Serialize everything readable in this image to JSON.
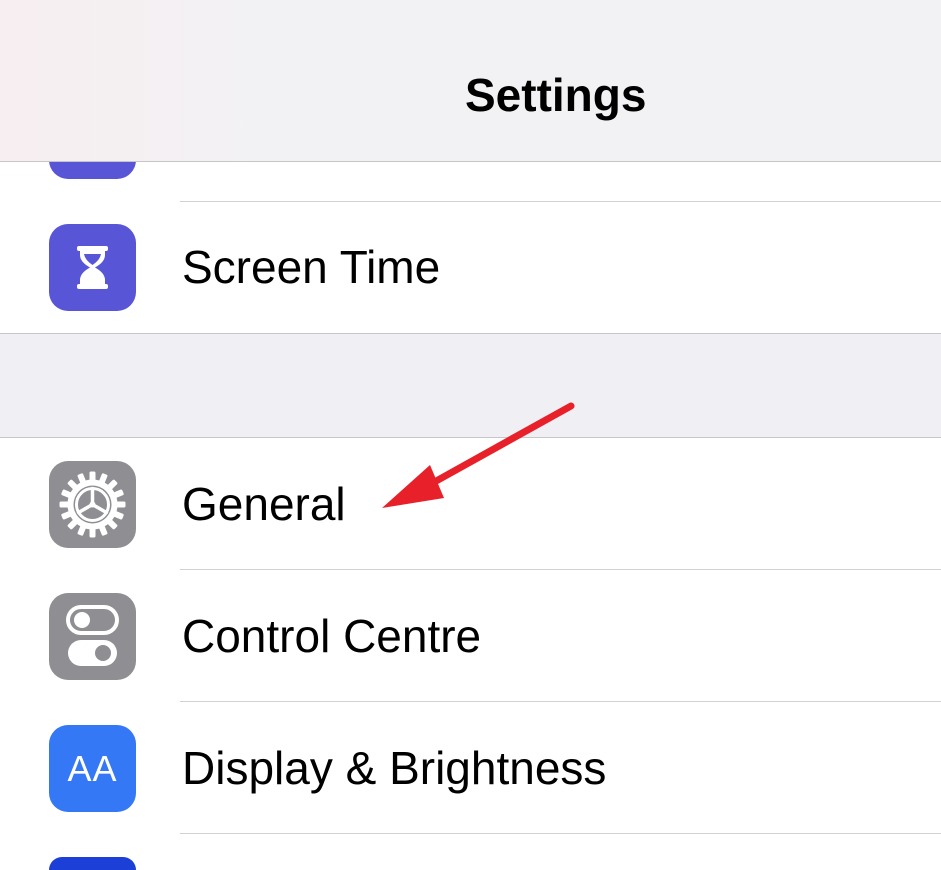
{
  "header": {
    "title": "Settings"
  },
  "colors": {
    "accent_purple": "#5856d6",
    "gray_icon": "#8e8e93",
    "blue_icon": "#3478f6",
    "dark_blue_icon": "#1c3fd8",
    "annotation_red": "#e8202a"
  },
  "rows": {
    "screen_time": {
      "label": "Screen Time",
      "icon": "hourglass-icon"
    },
    "general": {
      "label": "General",
      "icon": "gear-icon"
    },
    "control_centre": {
      "label": "Control Centre",
      "icon": "toggle-switches-icon"
    },
    "display": {
      "label": "Display & Brightness",
      "icon": "text-size-icon",
      "icon_text": "AA"
    }
  }
}
